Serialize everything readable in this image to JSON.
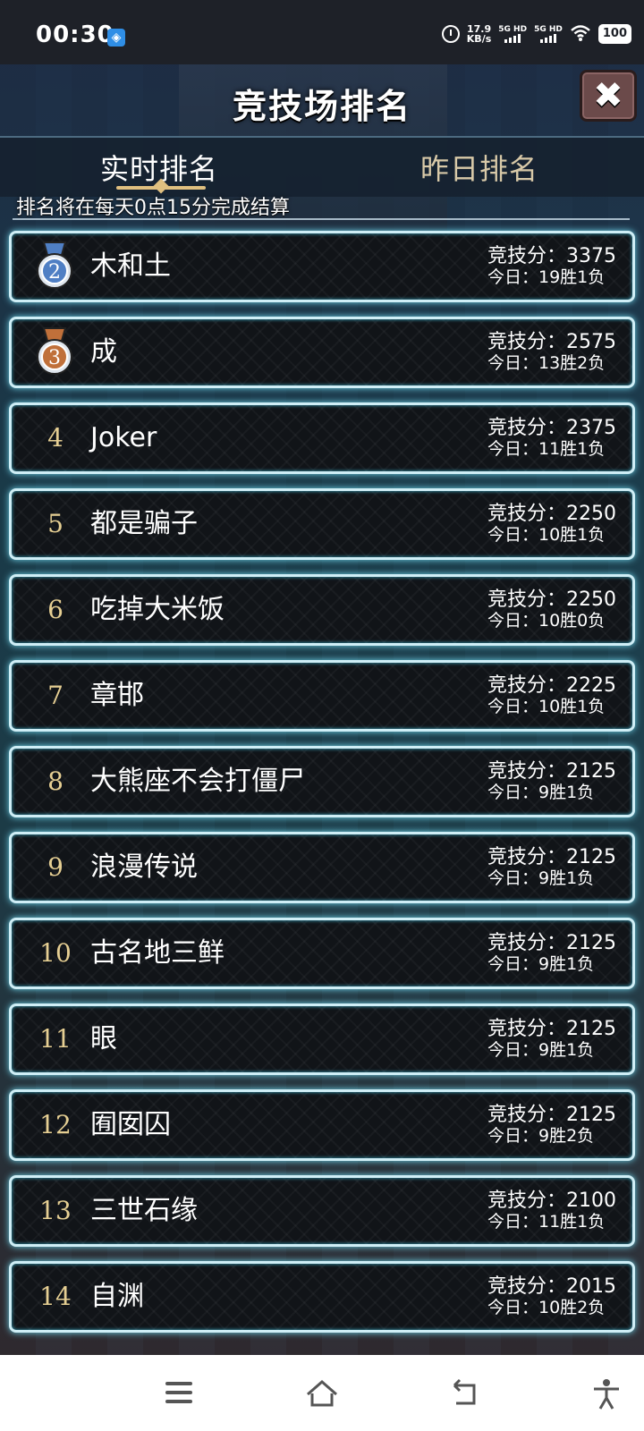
{
  "status_bar": {
    "time": "00:30",
    "net_speed_value": "17.9",
    "net_speed_unit": "KB/s",
    "sim1_label": "5G HD",
    "sim2_label": "5G HD",
    "battery": "100",
    "icons": [
      "app-notification-icon",
      "alarm-icon",
      "signal-icon",
      "wifi-icon",
      "battery-icon"
    ]
  },
  "header": {
    "title": "竞技场排名",
    "close_icon": "✖"
  },
  "tabs": [
    {
      "label": "实时排名",
      "active": true
    },
    {
      "label": "昨日排名",
      "active": false
    }
  ],
  "notice": "排名将在每天0点15分完成结算",
  "score_prefix": "竞技分：",
  "today_prefix": "今日：",
  "rankings": [
    {
      "rank": "2",
      "name": "木和土",
      "score": "3375",
      "today": "19胜1负",
      "medal": "silver"
    },
    {
      "rank": "3",
      "name": "成",
      "score": "2575",
      "today": "13胜2负",
      "medal": "bronze"
    },
    {
      "rank": "4",
      "name": "Joker",
      "score": "2375",
      "today": "11胜1负"
    },
    {
      "rank": "5",
      "name": "都是骗子",
      "score": "2250",
      "today": "10胜1负"
    },
    {
      "rank": "6",
      "name": "吃掉大米饭",
      "score": "2250",
      "today": "10胜0负"
    },
    {
      "rank": "7",
      "name": "章邯",
      "score": "2225",
      "today": "10胜1负"
    },
    {
      "rank": "8",
      "name": "大熊座不会打僵尸",
      "score": "2125",
      "today": "9胜1负"
    },
    {
      "rank": "9",
      "name": "浪漫传说",
      "score": "2125",
      "today": "9胜1负"
    },
    {
      "rank": "10",
      "name": "古名地三鲜",
      "score": "2125",
      "today": "9胜1负"
    },
    {
      "rank": "11",
      "name": "眼",
      "score": "2125",
      "today": "9胜1负"
    },
    {
      "rank": "12",
      "name": "囿囡囚",
      "score": "2125",
      "today": "9胜2负"
    },
    {
      "rank": "13",
      "name": "三世石缘",
      "score": "2100",
      "today": "11胜1负"
    },
    {
      "rank": "14",
      "name": "自渊",
      "score": "2015",
      "today": "10胜2负"
    }
  ],
  "colors": {
    "row_border": "#cfeef6",
    "rank_number": "#e6cf93",
    "medal_silver": "#4f7fc4",
    "medal_bronze": "#c0703a"
  }
}
